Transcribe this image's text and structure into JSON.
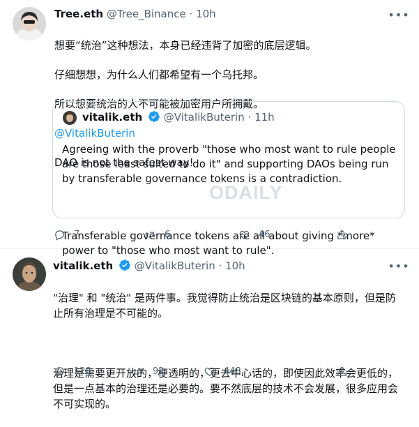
{
  "tweet1": {
    "display_name": "Tree.eth",
    "handle": "@Tree_Binance",
    "time": "10h",
    "lines": [
      "想要“统治”这种想法，本身已经违背了加密的底层逻辑。",
      "仔细想想，为什么人们都希望有一个乌托邦。",
      "所以想要统治的人不可能被加密用户所拥戴。"
    ],
    "mention": "@VitalikButerin",
    "last_line": "DAO is not the safest way!",
    "quote": {
      "display_name": "vitalik.eth",
      "handle": "@VitalikButerin",
      "time": "11h",
      "para1": "Agreeing with the proverb \"those who most want to rule people are those least suited to do it\" and supporting DAOs being run by transferable governance tokens is a contradiction.",
      "para2": "Transferable governance tokens are all about giving *more* power to \"those who most want to rule\"."
    },
    "watermark": "ODAILY",
    "stats": {
      "replies": "7",
      "retweets": "6",
      "likes": "46"
    }
  },
  "tweet2": {
    "display_name": "vitalik.eth",
    "handle": "@VitalikButerin",
    "time": "10h",
    "para1": "\"治理\" 和 \"统治\" 是两件事。我觉得防止统治是区块链的基本原则，但是防止所有治理是不可能的。",
    "para2": "治理是需要更开放的，梗透明的，更去中心话的，即使因此效率会更低的，但是一点基本的治理还是必要的。要不然底层的技术不会发展，很多应用会不可实现的。",
    "stats": {
      "replies": "128",
      "retweets": "92",
      "likes": "448"
    }
  },
  "icons": {
    "more": "more-dots-icon",
    "reply": "reply-bubble-icon",
    "retweet": "retweet-arrows-icon",
    "like": "heart-icon",
    "share": "share-upload-icon",
    "verified": "verified-badge-icon"
  },
  "colors": {
    "link": "#1d9bf0",
    "muted": "#536471",
    "text": "#0f1419",
    "border": "#cfd9de"
  }
}
